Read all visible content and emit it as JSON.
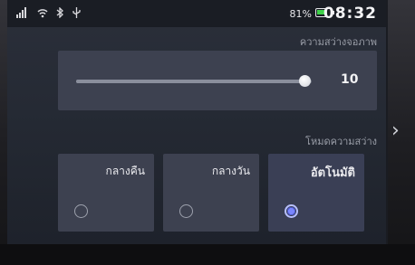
{
  "status_bar": {
    "signal_icon": "signal-icon",
    "wifi_icon": "wifi-icon",
    "bluetooth_icon": "bluetooth-icon",
    "usb_icon": "usb-icon",
    "battery_percent": "81%",
    "battery_level": 0.81,
    "battery_color": "#3fd14a",
    "time": "08:32"
  },
  "brightness": {
    "section_label": "ความสว่างจอภาพ",
    "value": "10",
    "level_fraction": 0.97
  },
  "mode": {
    "section_label": "โหมดความสว่าง",
    "options": [
      {
        "label": "กลางคืน",
        "selected": false
      },
      {
        "label": "กลางวัน",
        "selected": false
      },
      {
        "label": "อัตโนมัติ",
        "selected": true
      }
    ]
  },
  "navigation": {
    "next_icon": "chevron-right-icon",
    "next_glyph": "›"
  },
  "colors": {
    "accent": "#7a86ff",
    "panel": "#3d4150"
  }
}
